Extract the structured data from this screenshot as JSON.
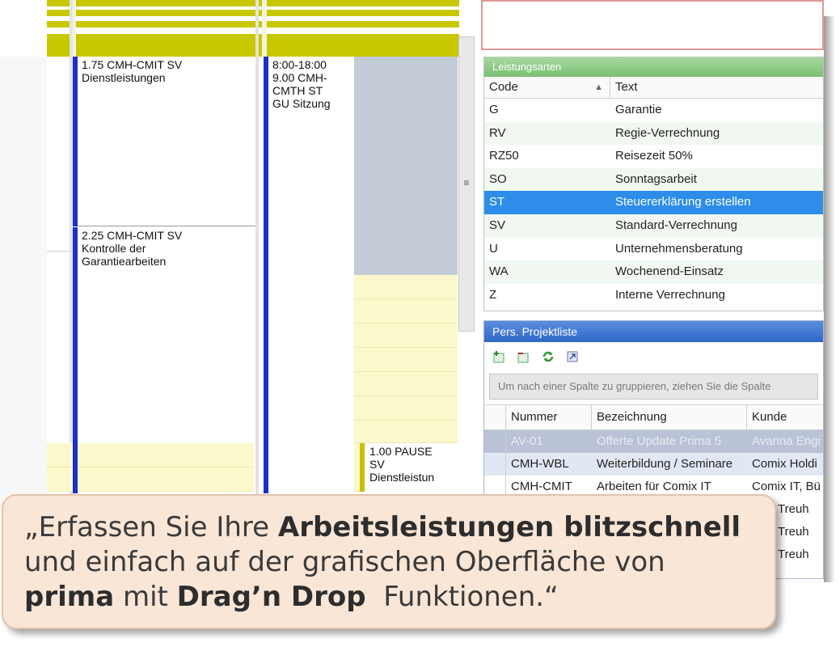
{
  "calendar": {
    "events": [
      {
        "line1": "1.75 CMH-CMIT SV",
        "line2": "Dienstleistungen"
      },
      {
        "line1": "2.25 CMH-CMIT SV",
        "line2": "Kontrolle der",
        "line3": "Garantiearbeiten"
      },
      {
        "line1": "8:00-18:00",
        "line2": "9.00 CMH-",
        "line3": "CMTH ST",
        "line4": "GU Sitzung"
      },
      {
        "line1": "1.00 PAUSE",
        "line2": "SV",
        "line3": "Dienstleistun"
      }
    ],
    "colors": {
      "event_bar": "#1c2fc8",
      "pause_bar": "#c8c000",
      "olive": "#c8c800"
    }
  },
  "leistungsarten": {
    "title": "Leistungsarten",
    "columns": {
      "code": "Code",
      "text": "Text"
    },
    "rows": [
      {
        "code": "G",
        "text": "Garantie"
      },
      {
        "code": "RV",
        "text": "Regie-Verrechnung"
      },
      {
        "code": "RZ50",
        "text": "Reisezeit 50%"
      },
      {
        "code": "SO",
        "text": "Sonntagsarbeit"
      },
      {
        "code": "ST",
        "text": "Steuererklärung erstellen"
      },
      {
        "code": "SV",
        "text": "Standard-Verrechnung"
      },
      {
        "code": "U",
        "text": "Unternehmensberatung"
      },
      {
        "code": "WA",
        "text": "Wochenend-Einsatz"
      },
      {
        "code": "Z",
        "text": "Interne Verrechnung"
      }
    ],
    "selected_code": "ST"
  },
  "projektliste": {
    "title": "Pers. Projektliste",
    "toolbar_icons": [
      "add-project-icon",
      "remove-project-icon",
      "refresh-icon",
      "export-icon"
    ],
    "group_hint": "Um nach einer Spalte zu gruppieren, ziehen Sie die Spalte",
    "columns": {
      "nummer": "Nummer",
      "bezeichnung": "Bezeichnung",
      "kunde": "Kunde"
    },
    "rows": [
      {
        "nummer": "AV-01",
        "bezeichnung": "Offerte Update Prima 5",
        "kunde": "Avanna Engi"
      },
      {
        "nummer": "CMH-WBL",
        "bezeichnung": "Weiterbildung / Seminare",
        "kunde": "Comix Holdi"
      },
      {
        "nummer": "CMH-CMIT",
        "bezeichnung": "Arbeiten für Comix IT",
        "kunde": "Comix IT, Bü"
      },
      {
        "nummer": "",
        "bezeichnung": "",
        "kunde": "Treuh"
      },
      {
        "nummer": "",
        "bezeichnung": "",
        "kunde": "Treuh"
      },
      {
        "nummer": "",
        "bezeichnung": "",
        "kunde": "Treuh"
      }
    ]
  },
  "quote": {
    "open": "„Erfassen Sie Ihre ",
    "bold1": "Arbeitsleistungen blitzschnell",
    "mid": "und einfach auf der grafischen Oberfläche von",
    "bold2": "prima",
    "mid2": " mit ",
    "bold3": "Drag’n Drop",
    "end": "  Funktionen.“"
  }
}
